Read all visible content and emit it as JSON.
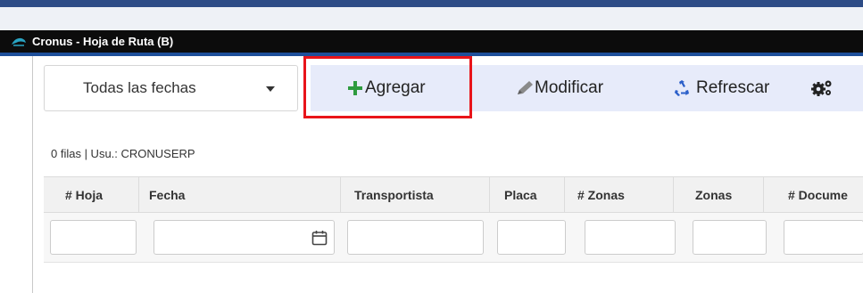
{
  "window": {
    "tab_title": "Cronus - Hoja de Ruta (B)"
  },
  "toolbar": {
    "date_filter": {
      "selected": "Todas las fechas"
    },
    "add_label": "Agregar",
    "edit_label": "Modificar",
    "refresh_label": "Refrescar"
  },
  "status": {
    "text": "0 filas | Usu.: CRONUSERP"
  },
  "grid": {
    "columns": [
      "# Hoja",
      "Fecha",
      "Transportista",
      "Placa",
      "# Zonas",
      "Zonas",
      "# Docume"
    ]
  },
  "colors": {
    "accent": "#1e4f9a",
    "add_icon": "#2e9b3f",
    "refresh_icon": "#2b5fc9",
    "highlight": "#e8141a",
    "toolbar_bg": "#e7ebfa"
  },
  "icons": {
    "app": "app-logo-icon",
    "add": "plus-icon",
    "edit": "pencil-icon",
    "refresh": "recycle-icon",
    "settings": "gears-icon",
    "calendar": "calendar-icon"
  }
}
